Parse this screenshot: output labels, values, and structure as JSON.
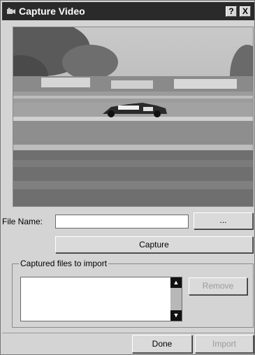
{
  "window": {
    "title": "Capture Video",
    "help_label": "?",
    "close_label": "X"
  },
  "file": {
    "label": "File Name:",
    "value": "",
    "browse_label": "..."
  },
  "capture_label": "Capture",
  "captured_group": {
    "title": "Captured files to import",
    "items": [],
    "remove_label": "Remove"
  },
  "footer": {
    "done_label": "Done",
    "import_label": "Import"
  },
  "icons": {
    "app": "video-camera-icon",
    "scroll_up": "scroll-up-arrow-icon",
    "scroll_down": "scroll-down-arrow-icon"
  },
  "colors": {
    "titlebar": "#2a2a2a",
    "dialog": "#d4d4d4"
  }
}
